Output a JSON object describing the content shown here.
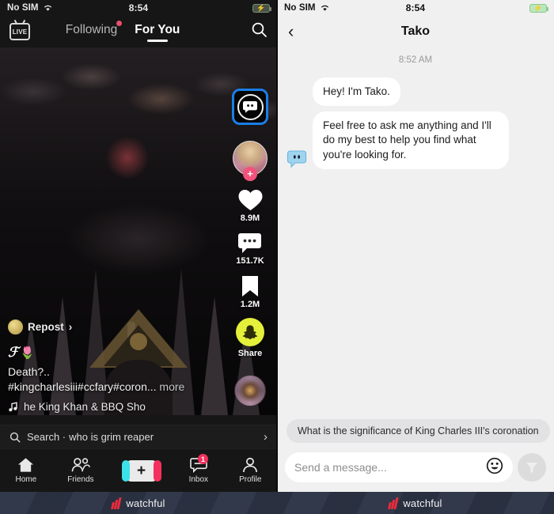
{
  "left": {
    "status": {
      "carrier": "No SIM",
      "time": "8:54",
      "wifi_icon": "wifi-icon",
      "battery_icon": "battery-charging-icon"
    },
    "header": {
      "live_label": "LIVE",
      "tabs": [
        {
          "label": "Following",
          "active": false,
          "has_dot": true
        },
        {
          "label": "For You",
          "active": true,
          "has_dot": false
        }
      ],
      "search_icon": "search-icon"
    },
    "rail": {
      "tako_icon": "tako-bot-icon",
      "tako_selected": true,
      "follow_plus": "+",
      "like": {
        "icon": "heart-icon",
        "count": "8.9M"
      },
      "comment": {
        "icon": "comment-icon",
        "count": "151.7K"
      },
      "bookmark": {
        "icon": "bookmark-icon",
        "count": "1.2M"
      },
      "share": {
        "icon": "snapchat-icon",
        "label": "Share"
      },
      "record_icon": "spinning-record-icon"
    },
    "caption": {
      "repost_label": "Repost",
      "repost_chevron": "›",
      "username": "ℱ",
      "username_emoji": "🌷",
      "line1": "Death?..",
      "hashtags": "#kingcharlesiii#ccfary#coron...",
      "more_label": "more",
      "music_icon": "music-note-icon",
      "music_text": "he King Khan & BBQ Sho"
    },
    "searchbar": {
      "icon": "search-icon",
      "label": "Search ·",
      "query": "who is grim reaper",
      "chevron": "›"
    },
    "nav": [
      {
        "icon": "home-icon",
        "label": "Home",
        "badge": ""
      },
      {
        "icon": "friends-icon",
        "label": "Friends",
        "badge": ""
      },
      {
        "icon": "plus-icon",
        "label": "",
        "badge": "",
        "glyph": "+"
      },
      {
        "icon": "inbox-icon",
        "label": "Inbox",
        "badge": "1"
      },
      {
        "icon": "profile-icon",
        "label": "Profile",
        "badge": ""
      }
    ]
  },
  "right": {
    "status": {
      "carrier": "No SIM",
      "time": "8:54",
      "wifi_icon": "wifi-icon",
      "battery_icon": "battery-charging-icon"
    },
    "header": {
      "back_icon": "back-chevron-icon",
      "title": "Tako"
    },
    "conversation": {
      "timestamp": "8:52 AM",
      "messages": [
        {
          "sender": "bot",
          "text": "Hey! I'm Tako.",
          "show_avatar": false
        },
        {
          "sender": "bot",
          "text": "Feel free to ask me anything and I'll do my best to help you find what you're looking for.",
          "show_avatar": true
        }
      ]
    },
    "suggestion": "What is the significance of King Charles III's coronation",
    "input": {
      "placeholder": "Send a message...",
      "emoji_icon": "emoji-smiley-icon",
      "send_icon": "send-arrow-icon"
    }
  },
  "footer": {
    "watermark_text": "watchful",
    "logo_icon": "watchful-logo-icon",
    "logo_color": "#ec2b3c"
  }
}
